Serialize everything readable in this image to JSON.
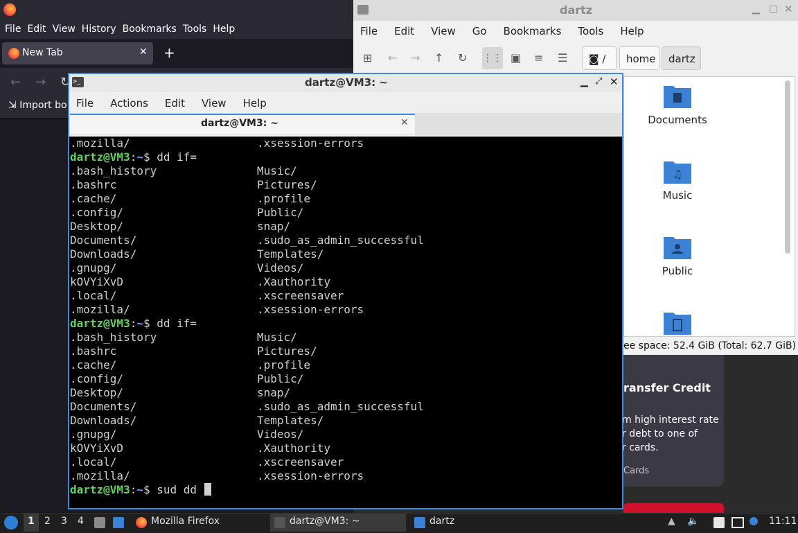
{
  "firefox": {
    "menu": [
      "File",
      "Edit",
      "View",
      "History",
      "Bookmarks",
      "Tools",
      "Help"
    ],
    "tab_label": "New Tab",
    "tab_close": "✕",
    "new_tab": "+",
    "import_bookmarks": "Import bo"
  },
  "file_manager": {
    "title": "dartz",
    "menu": [
      "File",
      "Edit",
      "View",
      "Go",
      "Bookmarks",
      "Tools",
      "Help"
    ],
    "breadcrumbs": [
      "/",
      "home",
      "dartz"
    ],
    "items": [
      "Documents",
      "Music",
      "Public",
      ""
    ],
    "status": "ee space: 52.4 GiB (Total: 62.7 GiB)",
    "folder_color": "#3b82d6"
  },
  "background_card": {
    "title": "ransfer Credit",
    "lines": [
      "m high interest rate",
      "r debt to one of",
      "r cards."
    ],
    "link": "Cards"
  },
  "terminal": {
    "title": "dartz@VM3: ~",
    "menu": [
      "File",
      "Actions",
      "Edit",
      "View",
      "Help"
    ],
    "tab_label": "dartz@VM3: ~",
    "prompt_user": "dartz@VM3",
    "prompt_path": "~",
    "lines": [
      {
        "c1": ".mozilla/",
        "c2": ".xsession-errors"
      },
      {
        "prompt": true,
        "cmd": " dd if="
      },
      {
        "c1": ".bash_history",
        "c2": "Music/"
      },
      {
        "c1": ".bashrc",
        "c2": "Pictures/"
      },
      {
        "c1": ".cache/",
        "c2": ".profile"
      },
      {
        "c1": ".config/",
        "c2": "Public/"
      },
      {
        "c1": "Desktop/",
        "c2": "snap/"
      },
      {
        "c1": "Documents/",
        "c2": ".sudo_as_admin_successful"
      },
      {
        "c1": "Downloads/",
        "c2": "Templates/"
      },
      {
        "c1": ".gnupg/",
        "c2": "Videos/"
      },
      {
        "c1": "kOVYiXvD",
        "c2": ".Xauthority"
      },
      {
        "c1": ".local/",
        "c2": ".xscreensaver"
      },
      {
        "c1": ".mozilla/",
        "c2": ".xsession-errors"
      },
      {
        "prompt": true,
        "cmd": " dd if="
      },
      {
        "c1": ".bash_history",
        "c2": "Music/"
      },
      {
        "c1": ".bashrc",
        "c2": "Pictures/"
      },
      {
        "c1": ".cache/",
        "c2": ".profile"
      },
      {
        "c1": ".config/",
        "c2": "Public/"
      },
      {
        "c1": "Desktop/",
        "c2": "snap/"
      },
      {
        "c1": "Documents/",
        "c2": ".sudo_as_admin_successful"
      },
      {
        "c1": "Downloads/",
        "c2": "Templates/"
      },
      {
        "c1": ".gnupg/",
        "c2": "Videos/"
      },
      {
        "c1": "kOVYiXvD",
        "c2": ".Xauthority"
      },
      {
        "c1": ".local/",
        "c2": ".xscreensaver"
      },
      {
        "c1": ".mozilla/",
        "c2": ".xsession-errors"
      },
      {
        "prompt": true,
        "cmd": " sud dd ",
        "cursor": true
      }
    ]
  },
  "taskbar": {
    "workspaces": [
      "1",
      "2",
      "3",
      "4"
    ],
    "tasks": [
      "Mozilla Firefox",
      "dartz@VM3: ~",
      "dartz"
    ],
    "clock": "11:11"
  }
}
